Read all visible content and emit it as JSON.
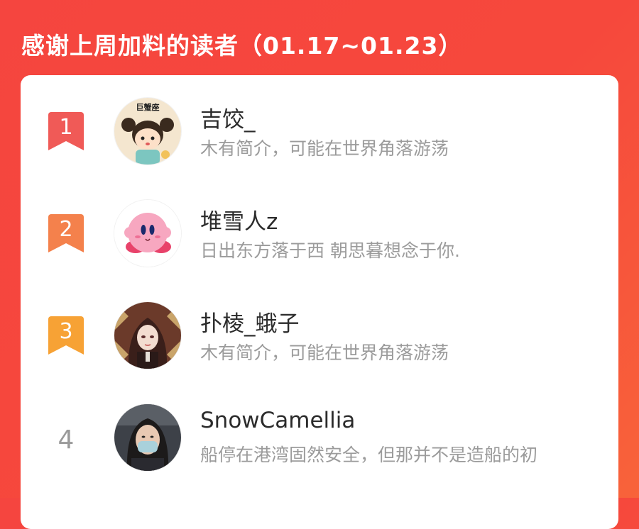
{
  "header": {
    "title": "感谢上周加料的读者（01.17~01.23）"
  },
  "colors": {
    "rank1": "#f05a57",
    "rank2": "#f4814c",
    "rank3": "#f7a235",
    "background": "#f5453f"
  },
  "readers": [
    {
      "rank": "1",
      "name": "吉饺_",
      "bio": "木有简介，可能在世界角落游荡",
      "avatar_badge": "巨蟹座"
    },
    {
      "rank": "2",
      "name": "堆雪人z",
      "bio": "日出东方落于西 朝思暮想念于你."
    },
    {
      "rank": "3",
      "name": "扑棱_蛾子",
      "bio": "木有简介，可能在世界角落游荡"
    },
    {
      "rank": "4",
      "name": "SnowCamellia",
      "bio": "船停在港湾固然安全，但那并不是造船的初"
    }
  ]
}
